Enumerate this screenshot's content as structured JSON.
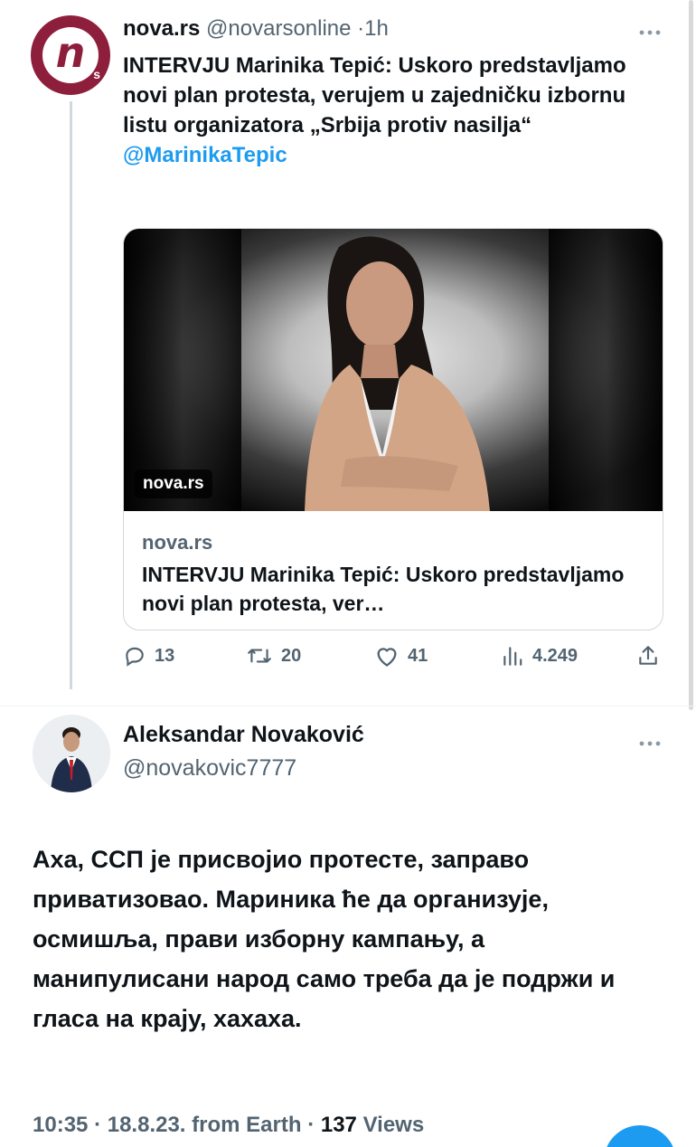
{
  "tweet1": {
    "author_name": "nova.rs",
    "author_handle": "@novarsonline",
    "separator": "·",
    "time": "1h",
    "avatar_mark": "n",
    "avatar_sub": "s",
    "text": "INTERVJU Marinika Tepić: Uskoro predstavljamo novi plan protesta, verujem u zajedničku izbornu listu organizatora „Srbija protiv nasilja“",
    "mention": "@MarinikaTepic",
    "card": {
      "image_badge": "nova.rs",
      "domain": "nova.rs",
      "title": "INTERVJU Marinika Tepić: Uskoro predstavljamo novi plan protesta, ver…"
    },
    "actions": {
      "replies": "13",
      "retweets": "20",
      "likes": "41",
      "views": "4.249"
    }
  },
  "tweet2": {
    "author_name": "Aleksandar Novaković",
    "author_handle": "@novakovic7777",
    "text": "Аха, ССП је присвојио протесте, заправо приватизовао. Мариника ће да организује, осмишља, прави изборну кампању, а манипулисани народ само треба да је подржи и гласа на крају, хахаха.",
    "meta": {
      "time": "10:35",
      "date": "18.8.23.",
      "source": "from Earth",
      "views_count": "137",
      "views_label": "Views"
    }
  },
  "icons": {
    "more": "more-icon",
    "reply": "reply-icon",
    "retweet": "retweet-icon",
    "like": "heart-icon",
    "views": "views-icon",
    "share": "share-icon",
    "compose": "compose-icon"
  },
  "colors": {
    "accent": "#1d9bf0",
    "brand": "#8e1f3c",
    "muted_text": "#536471",
    "primary_text": "#0f1419"
  }
}
